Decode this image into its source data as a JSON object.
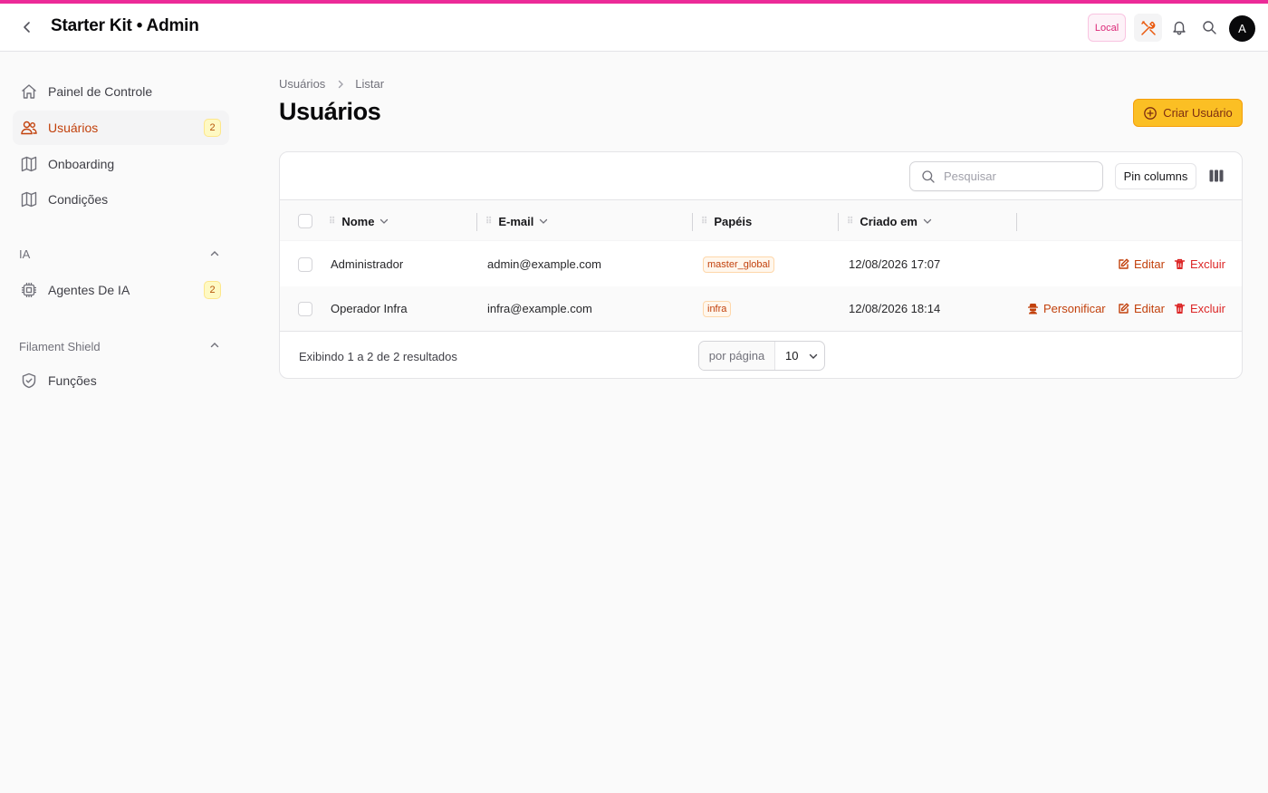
{
  "colors": {
    "accent_bar": "#ec2a98",
    "primary": "#fbbf24",
    "active_nav": "#c2410c",
    "danger": "#dc2626"
  },
  "header": {
    "title": "Starter Kit • Admin",
    "env_badge": "Local",
    "avatar_initial": "A",
    "icons": [
      "chevron-left-icon",
      "tools-icon",
      "bell-icon",
      "search-icon"
    ]
  },
  "sidebar": {
    "items": [
      {
        "label": "Painel de Controle",
        "icon": "home-icon"
      },
      {
        "label": "Usuários",
        "icon": "users-icon",
        "badge": "2",
        "active": true
      },
      {
        "label": "Onboarding",
        "icon": "map-icon"
      },
      {
        "label": "Condições",
        "icon": "map-icon"
      }
    ],
    "groups": [
      {
        "label": "IA",
        "items": [
          {
            "label": "Agentes De IA",
            "icon": "cpu-chip-icon",
            "badge": "2"
          }
        ]
      },
      {
        "label": "Filament Shield",
        "items": [
          {
            "label": "Funções",
            "icon": "shield-check-icon"
          }
        ]
      }
    ]
  },
  "breadcrumb": [
    "Usuários",
    "Listar"
  ],
  "page": {
    "title": "Usuários",
    "create_button": "Criar Usuário"
  },
  "table": {
    "search_placeholder": "Pesquisar",
    "pin_columns_label": "Pin columns",
    "columns": [
      "Nome",
      "E-mail",
      "Papéis",
      "Criado em"
    ],
    "rows": [
      {
        "nome": "Administrador",
        "email": "admin@example.com",
        "papel": "master_global",
        "criado_em": "12/08/2026 17:07",
        "actions": [
          "Editar",
          "Excluir"
        ]
      },
      {
        "nome": "Operador Infra",
        "email": "infra@example.com",
        "papel": "infra",
        "criado_em": "12/08/2026 18:14",
        "actions": [
          "Personificar",
          "Editar",
          "Excluir"
        ]
      }
    ],
    "footer": {
      "results_text": "Exibindo 1 a 2 de 2 resultados",
      "per_page_label": "por página",
      "per_page_value": "10"
    }
  }
}
